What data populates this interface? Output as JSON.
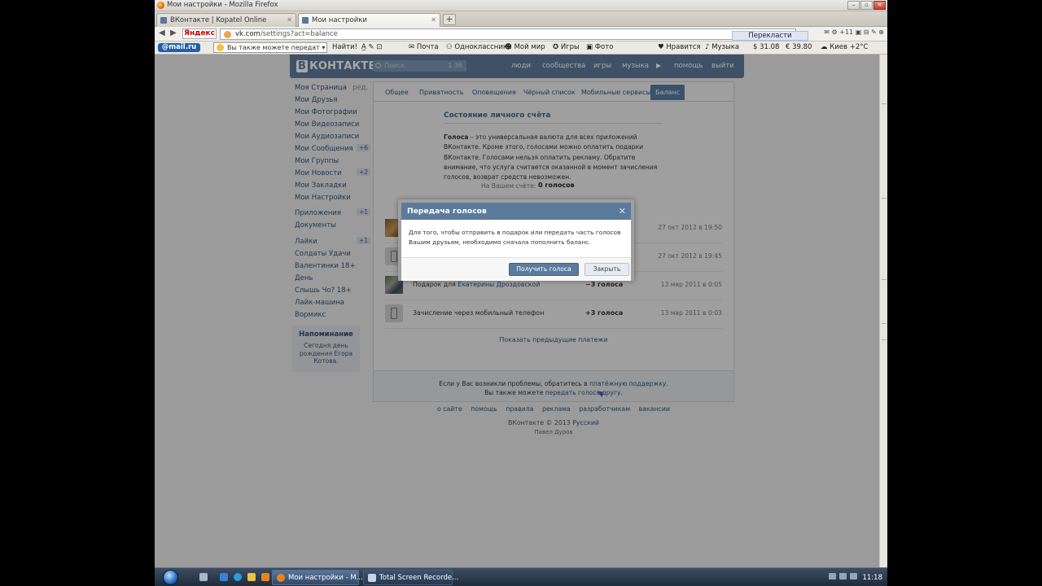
{
  "window": {
    "title": "Мои настройки - Mozilla Firefox"
  },
  "tabs": [
    {
      "label": "ВКонтакте | Kopatel Online"
    },
    {
      "label": "Мои настройки"
    }
  ],
  "navbar": {
    "yandex": "Яндекс",
    "url_host": "vk.com",
    "url_path": "/settings?act=balance",
    "translate_btn": "Перекласти",
    "right_badge": "+11"
  },
  "bookmarks": {
    "mailru": "@mail.ru",
    "search_placeholder": "Вы также можете передат",
    "find": "Найти!",
    "items": [
      "Почта",
      "Одноклассники",
      "Мой мир",
      "Игры",
      "Фото"
    ],
    "like": "Нравится",
    "music": "Музыка",
    "usd": "31.08",
    "eur": "39.80",
    "weather": "Киев +2°C"
  },
  "vk": {
    "logo_mark": "В",
    "logo": "КОНТАКТЕ",
    "search_placeholder": "Поиск",
    "search_count": "1 36",
    "nav": [
      "люди",
      "сообщества",
      "игры",
      "музыка",
      "помощь",
      "выйти"
    ]
  },
  "leftmenu": {
    "edit": "ред.",
    "items": [
      {
        "label": "Моя Страница",
        "count": ""
      },
      {
        "label": "Мои Друзья",
        "count": ""
      },
      {
        "label": "Мои Фотографии",
        "count": ""
      },
      {
        "label": "Мои Видеозаписи",
        "count": ""
      },
      {
        "label": "Мои Аудиозаписи",
        "count": ""
      },
      {
        "label": "Мои Сообщения",
        "count": "+6"
      },
      {
        "label": "Мои Группы",
        "count": ""
      },
      {
        "label": "Мои Новости",
        "count": "+2"
      },
      {
        "label": "Мои Закладки",
        "count": ""
      },
      {
        "label": "Мои Настройки",
        "count": ""
      },
      {
        "label": "Приложения",
        "count": "+1"
      },
      {
        "label": "Документы",
        "count": ""
      },
      {
        "label": "Лайки",
        "count": "+1"
      },
      {
        "label": "Солдаты Удачи",
        "count": ""
      },
      {
        "label": "Валентинки 18+",
        "count": ""
      },
      {
        "label": "День",
        "count": ""
      },
      {
        "label": "Слышь Чо? 18+",
        "count": ""
      },
      {
        "label": "Лайк-машина",
        "count": ""
      },
      {
        "label": "Вормикс",
        "count": ""
      }
    ]
  },
  "reminder": {
    "title": "Напоминание",
    "line1": "Сегодня день",
    "line2_pre": "рождения ",
    "line2_link": "Егора",
    "line3": "Котова."
  },
  "settings_tabs": [
    "Общее",
    "Приватность",
    "Оповещения",
    "Чёрный список",
    "Мобильные сервисы",
    "Баланс"
  ],
  "balance": {
    "title": "Состояние личного счёта",
    "text_bold": "Голоса",
    "text": " – это универсальная валюта для всех приложений ВКонтакте. Кроме этого, голосами можно оплатить подарки ВКонтакте. Голосами нельзя оплатить рекламу. Обратите внимание, что услуга считается оказанной в момент зачисления голосов, возврат средств невозможен.",
    "label": "На Вашем счёте:",
    "value": "0 голосов"
  },
  "transactions": [
    {
      "desc": "",
      "link": "",
      "amount": "",
      "date": "27 окт 2012 в 19:50"
    },
    {
      "desc": "",
      "link": "",
      "amount": "",
      "date": "27 окт 2012 в 19:45"
    },
    {
      "desc": "Подарок для ",
      "link": "Екатерины Дроздовской",
      "amount": "−3 голоса",
      "date": "13 мар 2011 в 0:05"
    },
    {
      "desc": "Зачисление через мобильный телефон",
      "link": "",
      "amount": "+3 голоса",
      "date": "13 мар 2011 в 0:03"
    }
  ],
  "show_prev": "Показать предыдущие платежи",
  "support": {
    "line1_pre": "Если у Вас возникли проблемы, обратитесь в ",
    "line1_link": "платёжную поддержку",
    "line1_post": ".",
    "line2_pre": "Вы также можете ",
    "line2_link": "передать голоса другу",
    "line2_post": "."
  },
  "footer": {
    "links": [
      "о сайте",
      "помощь",
      "правила",
      "реклама",
      "разработчикам",
      "вакансии"
    ],
    "copy": "ВКонтакте © 2013 ",
    "lang": "Русский",
    "author": "Павел Дуров"
  },
  "modal": {
    "title": "Передача голосов",
    "body": "Для того, чтобы отправить в подарок или передать часть голосов Вашим друзьям, необходимо сначала пополнить баланс.",
    "primary": "Получить голоса",
    "secondary": "Закрыть"
  },
  "taskbar": {
    "tasks": [
      "Мои настройки - M...",
      "Total Screen Recorde..."
    ],
    "clock": "11:18"
  }
}
